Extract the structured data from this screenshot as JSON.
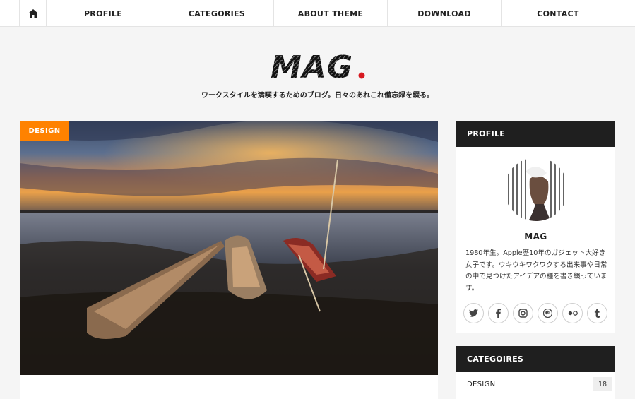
{
  "nav": {
    "home_icon": "home-icon",
    "items": [
      {
        "label": "PROFILE"
      },
      {
        "label": "CATEGORIES"
      },
      {
        "label": "ABOUT THEME"
      },
      {
        "label": "DOWNLOAD"
      },
      {
        "label": "CONTACT"
      }
    ]
  },
  "header": {
    "logo_text": "MAG",
    "logo_dot_color": "#d71920",
    "tagline": "ワークスタイルを満喫するためのブログ。日々のあれこれ備忘録を綴る。"
  },
  "featured": {
    "category": "DESIGN",
    "category_color": "#ff8200",
    "image": "sunset-boats-photo"
  },
  "sidebar": {
    "profile": {
      "title": "PROFILE",
      "name": "MAG",
      "bio": "1980年生。Apple歴10年のガジェット大好き女子です。ウキウキワクワクする出来事や日常の中で見つけたアイデアの種を書き綴っています。",
      "social": [
        {
          "icon": "twitter-icon",
          "glyph": "t"
        },
        {
          "icon": "facebook-icon",
          "glyph": "f"
        },
        {
          "icon": "instagram-icon",
          "glyph": "◎"
        },
        {
          "icon": "pinterest-icon",
          "glyph": "p"
        },
        {
          "icon": "flickr-icon",
          "glyph": "••"
        },
        {
          "icon": "tumblr-icon",
          "glyph": "t"
        }
      ]
    },
    "categories": {
      "title": "CATEGOIRES",
      "items": [
        {
          "label": "DESIGN",
          "count": "18"
        }
      ]
    }
  }
}
